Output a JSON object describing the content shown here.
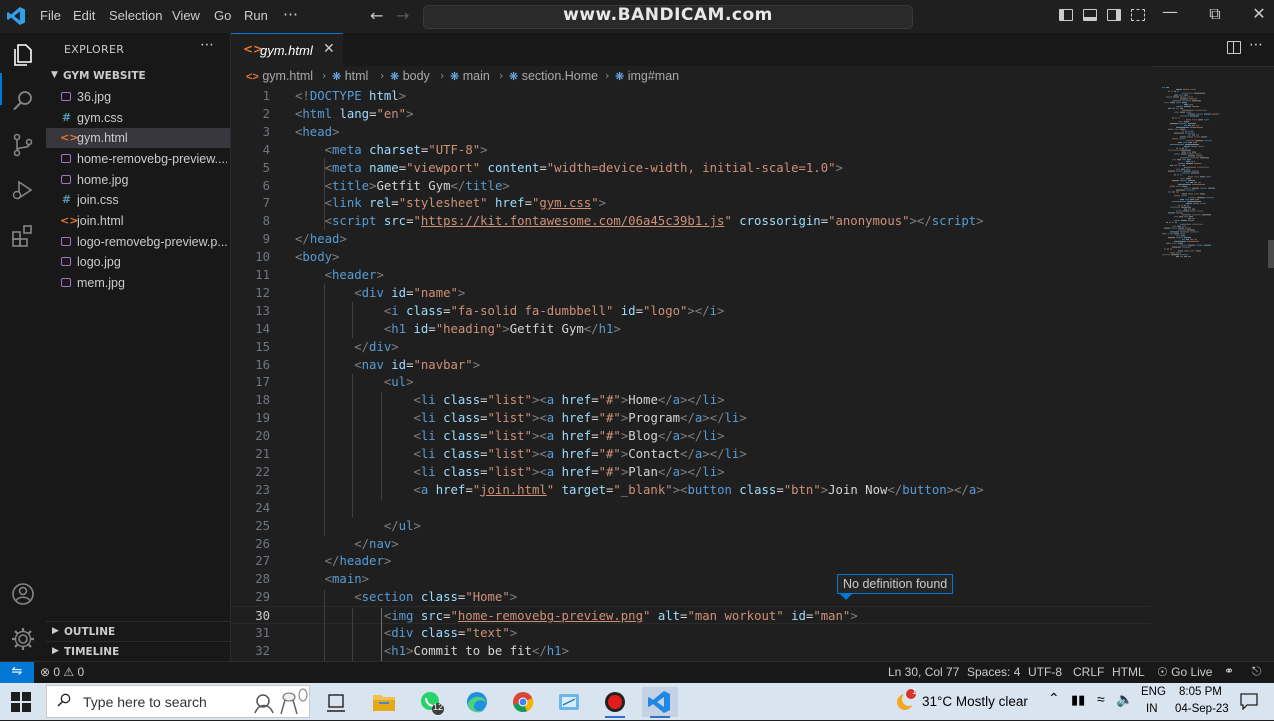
{
  "titlebar": {
    "menus": [
      "File",
      "Edit",
      "Selection",
      "View",
      "Go",
      "Run"
    ],
    "more": "⋯",
    "command_center": "www.BANDICAM.com"
  },
  "sidebar": {
    "title": "EXPLORER",
    "more": "⋯",
    "folder": "GYM WEBSITE",
    "files": [
      {
        "name": "36.jpg",
        "type": "image"
      },
      {
        "name": "gym.css",
        "type": "css"
      },
      {
        "name": "gym.html",
        "type": "html",
        "selected": true
      },
      {
        "name": "home-removebg-preview....",
        "type": "image"
      },
      {
        "name": "home.jpg",
        "type": "image"
      },
      {
        "name": "join.css",
        "type": "css"
      },
      {
        "name": "join.html",
        "type": "html"
      },
      {
        "name": "logo-removebg-preview.p...",
        "type": "image"
      },
      {
        "name": "logo.jpg",
        "type": "image"
      },
      {
        "name": "mem.jpg",
        "type": "image"
      }
    ],
    "outline": "OUTLINE",
    "timeline": "TIMELINE"
  },
  "tab": {
    "label": "gym.html",
    "close": "✕"
  },
  "breadcrumb": [
    "gym.html",
    "html",
    "body",
    "main",
    "section.Home",
    "img#man"
  ],
  "editor": {
    "current_line": 30,
    "lines": [
      [
        [
          "br",
          "<!"
        ],
        [
          "tag",
          "DOCTYPE"
        ],
        [
          "txt",
          " "
        ],
        [
          "attr",
          "html"
        ],
        [
          "br",
          ">"
        ]
      ],
      [
        [
          "br",
          "<"
        ],
        [
          "tag",
          "html"
        ],
        [
          "txt",
          " "
        ],
        [
          "attr",
          "lang"
        ],
        [
          "txt",
          "="
        ],
        [
          "str",
          "\"en\""
        ],
        [
          "br",
          ">"
        ]
      ],
      [
        [
          "br",
          "<"
        ],
        [
          "tag",
          "head"
        ],
        [
          "br",
          ">"
        ]
      ],
      [
        [
          "txt",
          "    "
        ],
        [
          "br",
          "<"
        ],
        [
          "tag",
          "meta"
        ],
        [
          "txt",
          " "
        ],
        [
          "attr",
          "charset"
        ],
        [
          "txt",
          "="
        ],
        [
          "str",
          "\"UTF-8\""
        ],
        [
          "br",
          ">"
        ]
      ],
      [
        [
          "txt",
          "    "
        ],
        [
          "br",
          "<"
        ],
        [
          "tag",
          "meta"
        ],
        [
          "txt",
          " "
        ],
        [
          "attr",
          "name"
        ],
        [
          "txt",
          "="
        ],
        [
          "str",
          "\"viewport\""
        ],
        [
          "txt",
          " "
        ],
        [
          "attr",
          "content"
        ],
        [
          "txt",
          "="
        ],
        [
          "str",
          "\"width=device-width, initial-scale=1.0\""
        ],
        [
          "br",
          ">"
        ]
      ],
      [
        [
          "txt",
          "    "
        ],
        [
          "br",
          "<"
        ],
        [
          "tag",
          "title"
        ],
        [
          "br",
          ">"
        ],
        [
          "txt",
          "Getfit Gym"
        ],
        [
          "br",
          "</"
        ],
        [
          "tag",
          "title"
        ],
        [
          "br",
          ">"
        ]
      ],
      [
        [
          "txt",
          "    "
        ],
        [
          "br",
          "<"
        ],
        [
          "tag",
          "link"
        ],
        [
          "txt",
          " "
        ],
        [
          "attr",
          "rel"
        ],
        [
          "txt",
          "="
        ],
        [
          "str",
          "\"stylesheet\""
        ],
        [
          "txt",
          " "
        ],
        [
          "attr",
          "href"
        ],
        [
          "txt",
          "="
        ],
        [
          "str",
          "\""
        ],
        [
          "link",
          "gym.css"
        ],
        [
          "str",
          "\""
        ],
        [
          "br",
          ">"
        ]
      ],
      [
        [
          "txt",
          "    "
        ],
        [
          "br",
          "<"
        ],
        [
          "tag",
          "script"
        ],
        [
          "txt",
          " "
        ],
        [
          "attr",
          "src"
        ],
        [
          "txt",
          "="
        ],
        [
          "str",
          "\""
        ],
        [
          "link",
          "https://kit.fontawesome.com/06a45c39b1.js"
        ],
        [
          "str",
          "\""
        ],
        [
          "txt",
          " "
        ],
        [
          "attr",
          "crossorigin"
        ],
        [
          "txt",
          "="
        ],
        [
          "str",
          "\"anonymous\""
        ],
        [
          "br",
          "></"
        ],
        [
          "tag",
          "script"
        ],
        [
          "br",
          ">"
        ]
      ],
      [
        [
          "br",
          "</"
        ],
        [
          "tag",
          "head"
        ],
        [
          "br",
          ">"
        ]
      ],
      [
        [
          "br",
          "<"
        ],
        [
          "tag",
          "body"
        ],
        [
          "br",
          ">"
        ]
      ],
      [
        [
          "txt",
          "    "
        ],
        [
          "br",
          "<"
        ],
        [
          "tag",
          "header"
        ],
        [
          "br",
          ">"
        ]
      ],
      [
        [
          "txt",
          "        "
        ],
        [
          "br",
          "<"
        ],
        [
          "tag",
          "div"
        ],
        [
          "txt",
          " "
        ],
        [
          "attr",
          "id"
        ],
        [
          "txt",
          "="
        ],
        [
          "str",
          "\"name\""
        ],
        [
          "br",
          ">"
        ]
      ],
      [
        [
          "txt",
          "            "
        ],
        [
          "br",
          "<"
        ],
        [
          "tag",
          "i"
        ],
        [
          "txt",
          " "
        ],
        [
          "attr",
          "class"
        ],
        [
          "txt",
          "="
        ],
        [
          "str",
          "\"fa-solid fa-dumbbell\""
        ],
        [
          "txt",
          " "
        ],
        [
          "attr",
          "id"
        ],
        [
          "txt",
          "="
        ],
        [
          "str",
          "\"logo\""
        ],
        [
          "br",
          "></"
        ],
        [
          "tag",
          "i"
        ],
        [
          "br",
          ">"
        ]
      ],
      [
        [
          "txt",
          "            "
        ],
        [
          "br",
          "<"
        ],
        [
          "tag",
          "h1"
        ],
        [
          "txt",
          " "
        ],
        [
          "attr",
          "id"
        ],
        [
          "txt",
          "="
        ],
        [
          "str",
          "\"heading\""
        ],
        [
          "br",
          ">"
        ],
        [
          "txt",
          "Getfit Gym"
        ],
        [
          "br",
          "</"
        ],
        [
          "tag",
          "h1"
        ],
        [
          "br",
          ">"
        ]
      ],
      [
        [
          "txt",
          "        "
        ],
        [
          "br",
          "</"
        ],
        [
          "tag",
          "div"
        ],
        [
          "br",
          ">"
        ]
      ],
      [
        [
          "txt",
          "        "
        ],
        [
          "br",
          "<"
        ],
        [
          "tag",
          "nav"
        ],
        [
          "txt",
          " "
        ],
        [
          "attr",
          "id"
        ],
        [
          "txt",
          "="
        ],
        [
          "str",
          "\"navbar\""
        ],
        [
          "br",
          ">"
        ]
      ],
      [
        [
          "txt",
          "            "
        ],
        [
          "br",
          "<"
        ],
        [
          "tag",
          "ul"
        ],
        [
          "br",
          ">"
        ]
      ],
      [
        [
          "txt",
          "                "
        ],
        [
          "br",
          "<"
        ],
        [
          "tag",
          "li"
        ],
        [
          "txt",
          " "
        ],
        [
          "attr",
          "class"
        ],
        [
          "txt",
          "="
        ],
        [
          "str",
          "\"list\""
        ],
        [
          "br",
          "><"
        ],
        [
          "tag",
          "a"
        ],
        [
          "txt",
          " "
        ],
        [
          "attr",
          "href"
        ],
        [
          "txt",
          "="
        ],
        [
          "str",
          "\"#\""
        ],
        [
          "br",
          ">"
        ],
        [
          "txt",
          "Home"
        ],
        [
          "br",
          "</"
        ],
        [
          "tag",
          "a"
        ],
        [
          "br",
          "></"
        ],
        [
          "tag",
          "li"
        ],
        [
          "br",
          ">"
        ]
      ],
      [
        [
          "txt",
          "                "
        ],
        [
          "br",
          "<"
        ],
        [
          "tag",
          "li"
        ],
        [
          "txt",
          " "
        ],
        [
          "attr",
          "class"
        ],
        [
          "txt",
          "="
        ],
        [
          "str",
          "\"list\""
        ],
        [
          "br",
          "><"
        ],
        [
          "tag",
          "a"
        ],
        [
          "txt",
          " "
        ],
        [
          "attr",
          "href"
        ],
        [
          "txt",
          "="
        ],
        [
          "str",
          "\"#\""
        ],
        [
          "br",
          ">"
        ],
        [
          "txt",
          "Program"
        ],
        [
          "br",
          "</"
        ],
        [
          "tag",
          "a"
        ],
        [
          "br",
          "></"
        ],
        [
          "tag",
          "li"
        ],
        [
          "br",
          ">"
        ]
      ],
      [
        [
          "txt",
          "                "
        ],
        [
          "br",
          "<"
        ],
        [
          "tag",
          "li"
        ],
        [
          "txt",
          " "
        ],
        [
          "attr",
          "class"
        ],
        [
          "txt",
          "="
        ],
        [
          "str",
          "\"list\""
        ],
        [
          "br",
          "><"
        ],
        [
          "tag",
          "a"
        ],
        [
          "txt",
          " "
        ],
        [
          "attr",
          "href"
        ],
        [
          "txt",
          "="
        ],
        [
          "str",
          "\"#\""
        ],
        [
          "br",
          ">"
        ],
        [
          "txt",
          "Blog"
        ],
        [
          "br",
          "</"
        ],
        [
          "tag",
          "a"
        ],
        [
          "br",
          "></"
        ],
        [
          "tag",
          "li"
        ],
        [
          "br",
          ">"
        ]
      ],
      [
        [
          "txt",
          "                "
        ],
        [
          "br",
          "<"
        ],
        [
          "tag",
          "li"
        ],
        [
          "txt",
          " "
        ],
        [
          "attr",
          "class"
        ],
        [
          "txt",
          "="
        ],
        [
          "str",
          "\"list\""
        ],
        [
          "br",
          "><"
        ],
        [
          "tag",
          "a"
        ],
        [
          "txt",
          " "
        ],
        [
          "attr",
          "href"
        ],
        [
          "txt",
          "="
        ],
        [
          "str",
          "\"#\""
        ],
        [
          "br",
          ">"
        ],
        [
          "txt",
          "Contact"
        ],
        [
          "br",
          "</"
        ],
        [
          "tag",
          "a"
        ],
        [
          "br",
          "></"
        ],
        [
          "tag",
          "li"
        ],
        [
          "br",
          ">"
        ]
      ],
      [
        [
          "txt",
          "                "
        ],
        [
          "br",
          "<"
        ],
        [
          "tag",
          "li"
        ],
        [
          "txt",
          " "
        ],
        [
          "attr",
          "class"
        ],
        [
          "txt",
          "="
        ],
        [
          "str",
          "\"list\""
        ],
        [
          "br",
          "><"
        ],
        [
          "tag",
          "a"
        ],
        [
          "txt",
          " "
        ],
        [
          "attr",
          "href"
        ],
        [
          "txt",
          "="
        ],
        [
          "str",
          "\"#\""
        ],
        [
          "br",
          ">"
        ],
        [
          "txt",
          "Plan"
        ],
        [
          "br",
          "</"
        ],
        [
          "tag",
          "a"
        ],
        [
          "br",
          "></"
        ],
        [
          "tag",
          "li"
        ],
        [
          "br",
          ">"
        ]
      ],
      [
        [
          "txt",
          "                "
        ],
        [
          "br",
          "<"
        ],
        [
          "tag",
          "a"
        ],
        [
          "txt",
          " "
        ],
        [
          "attr",
          "href"
        ],
        [
          "txt",
          "="
        ],
        [
          "str",
          "\""
        ],
        [
          "link",
          "join.html"
        ],
        [
          "str",
          "\""
        ],
        [
          "txt",
          " "
        ],
        [
          "attr",
          "target"
        ],
        [
          "txt",
          "="
        ],
        [
          "str",
          "\"_blank\""
        ],
        [
          "br",
          "><"
        ],
        [
          "tag",
          "button"
        ],
        [
          "txt",
          " "
        ],
        [
          "attr",
          "class"
        ],
        [
          "txt",
          "="
        ],
        [
          "str",
          "\"btn\""
        ],
        [
          "br",
          ">"
        ],
        [
          "txt",
          "Join Now"
        ],
        [
          "br",
          "</"
        ],
        [
          "tag",
          "button"
        ],
        [
          "br",
          "></"
        ],
        [
          "tag",
          "a"
        ],
        [
          "br",
          ">"
        ]
      ],
      [],
      [
        [
          "txt",
          "            "
        ],
        [
          "br",
          "</"
        ],
        [
          "tag",
          "ul"
        ],
        [
          "br",
          ">"
        ]
      ],
      [
        [
          "txt",
          "        "
        ],
        [
          "br",
          "</"
        ],
        [
          "tag",
          "nav"
        ],
        [
          "br",
          ">"
        ]
      ],
      [
        [
          "txt",
          "    "
        ],
        [
          "br",
          "</"
        ],
        [
          "tag",
          "header"
        ],
        [
          "br",
          ">"
        ]
      ],
      [
        [
          "txt",
          "    "
        ],
        [
          "br",
          "<"
        ],
        [
          "tag",
          "main"
        ],
        [
          "br",
          ">"
        ]
      ],
      [
        [
          "txt",
          "        "
        ],
        [
          "br",
          "<"
        ],
        [
          "tag",
          "section"
        ],
        [
          "txt",
          " "
        ],
        [
          "attr",
          "class"
        ],
        [
          "txt",
          "="
        ],
        [
          "str",
          "\"Home\""
        ],
        [
          "br",
          ">"
        ]
      ],
      [
        [
          "txt",
          "            "
        ],
        [
          "br",
          "<"
        ],
        [
          "tag",
          "img"
        ],
        [
          "txt",
          " "
        ],
        [
          "attr",
          "src"
        ],
        [
          "txt",
          "="
        ],
        [
          "str",
          "\""
        ],
        [
          "link",
          "home-removebg-preview.png"
        ],
        [
          "str",
          "\""
        ],
        [
          "txt",
          " "
        ],
        [
          "attr",
          "alt"
        ],
        [
          "txt",
          "="
        ],
        [
          "str",
          "\"man workout\""
        ],
        [
          "txt",
          " "
        ],
        [
          "attr",
          "id"
        ],
        [
          "txt",
          "="
        ],
        [
          "str",
          "\"man\""
        ],
        [
          "br",
          ">"
        ]
      ],
      [
        [
          "txt",
          "            "
        ],
        [
          "br",
          "<"
        ],
        [
          "tag",
          "div"
        ],
        [
          "txt",
          " "
        ],
        [
          "attr",
          "class"
        ],
        [
          "txt",
          "="
        ],
        [
          "str",
          "\"text\""
        ],
        [
          "br",
          ">"
        ]
      ],
      [
        [
          "txt",
          "            "
        ],
        [
          "br",
          "<"
        ],
        [
          "tag",
          "h1"
        ],
        [
          "br",
          ">"
        ],
        [
          "txt",
          "Commit to be fit"
        ],
        [
          "br",
          "</"
        ],
        [
          "tag",
          "h1"
        ],
        [
          "br",
          ">"
        ]
      ]
    ]
  },
  "hover": "No definition found",
  "statusbar": {
    "problems": "⊗ 0 ⚠ 0",
    "position": "Ln 30, Col 77",
    "spaces": "Spaces: 4",
    "encoding": "UTF-8",
    "eol": "CRLF",
    "language": "HTML",
    "golive": "Go Live"
  },
  "taskbar": {
    "search_placeholder": "Type here to search",
    "whatsapp_badge": "12",
    "weather_badge": "1",
    "weather": "31°C  Mostly clear",
    "lang_top": "ENG",
    "lang_bottom": "IN",
    "time": "8:05 PM",
    "date": "04-Sep-23"
  },
  "colors": {
    "accent": "#0078d4",
    "editor_bg": "#1f1f1f",
    "sidebar_bg": "#181818",
    "taskbar_bg": "#d9e4f1"
  }
}
